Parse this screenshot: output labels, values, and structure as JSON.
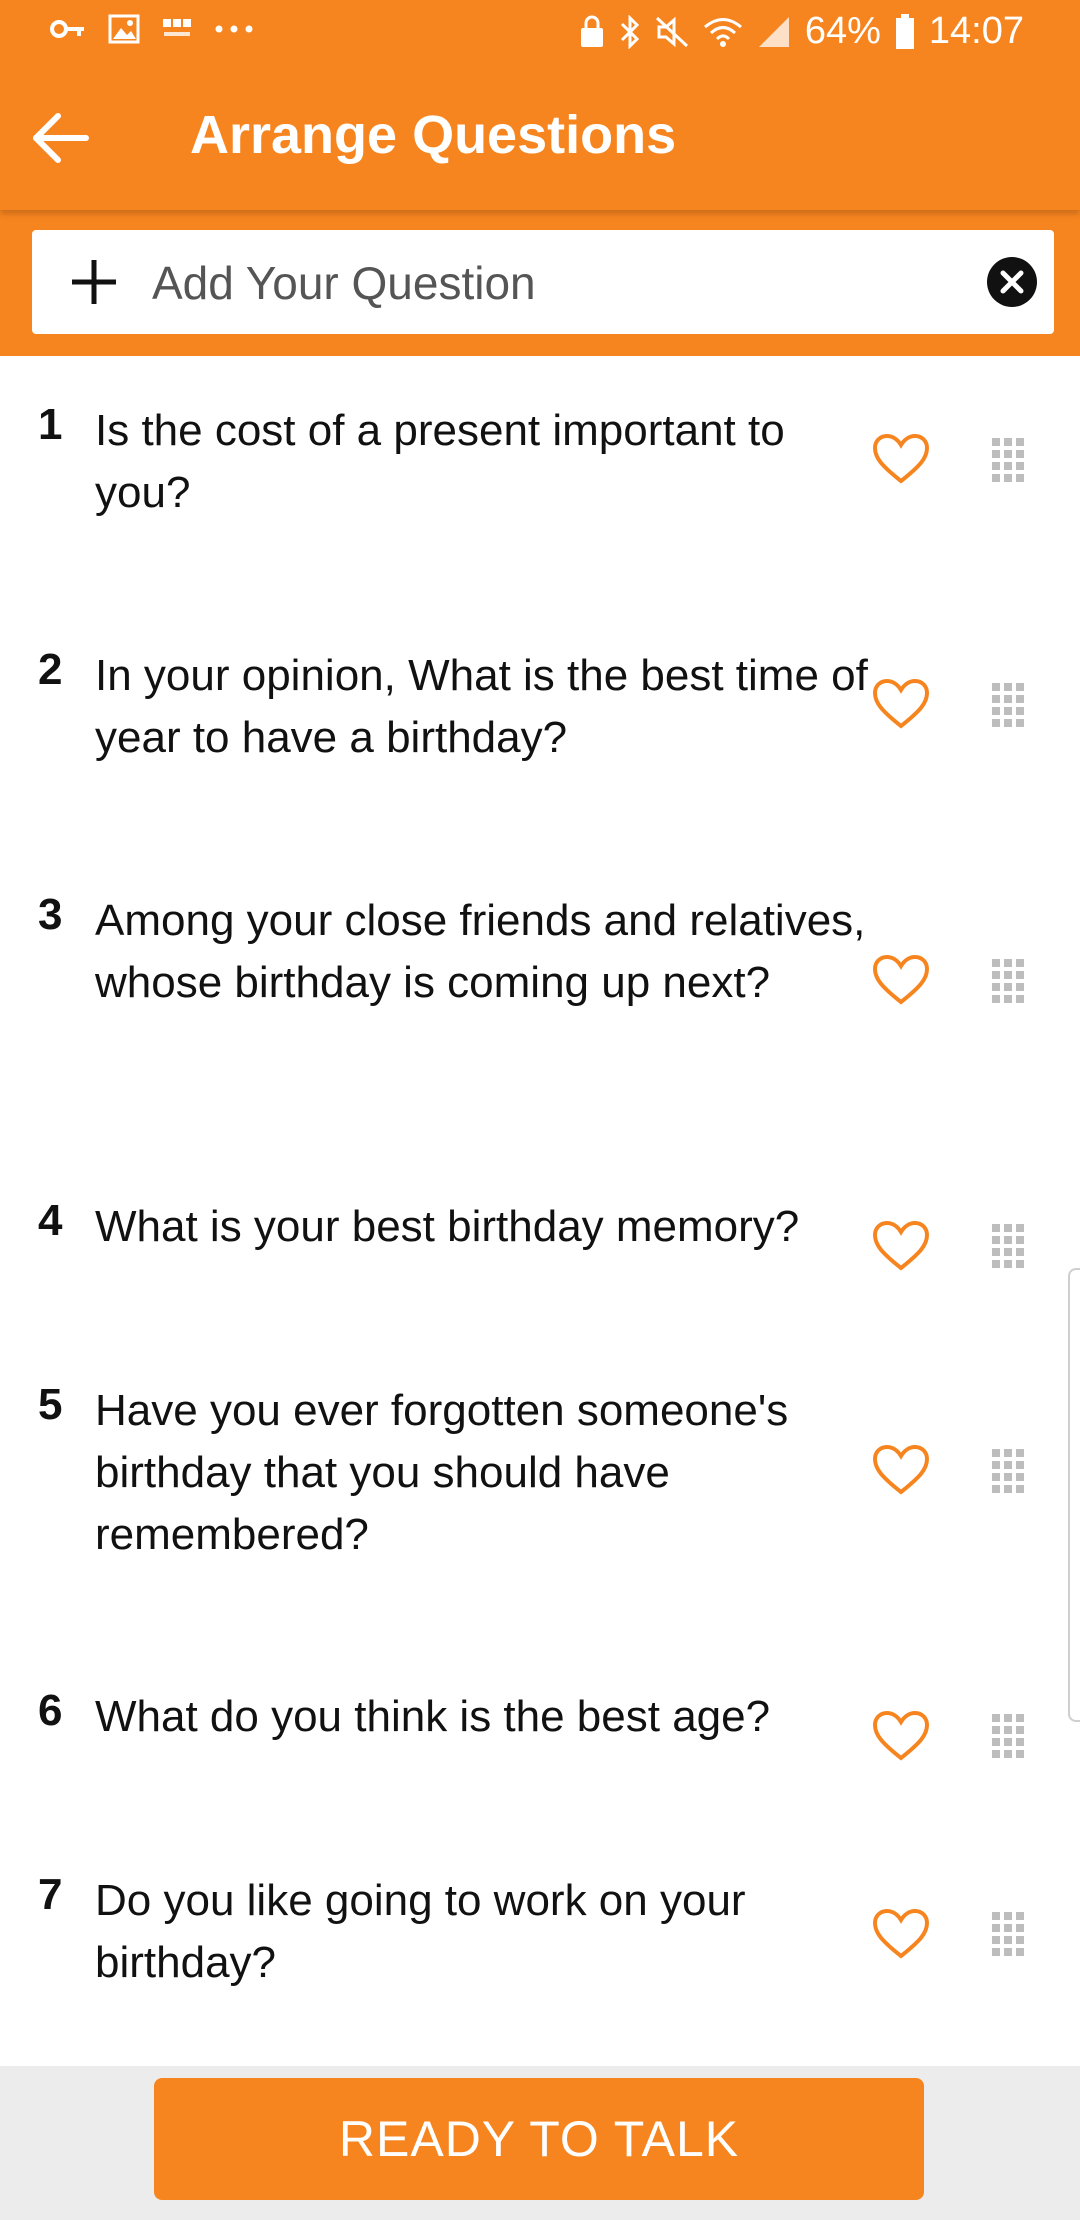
{
  "status_bar": {
    "battery": "64%",
    "time": "14:07"
  },
  "appbar": {
    "title": "Arrange Questions"
  },
  "add_question": {
    "placeholder": "Add Your Question"
  },
  "questions": [
    {
      "num": "1",
      "text": "Is the cost of a present important to you?"
    },
    {
      "num": "2",
      "text": "In your opinion, What is the best time of year to have a birthday?"
    },
    {
      "num": "3",
      "text": "Among your close friends and relatives, whose birthday is coming up next?"
    },
    {
      "num": "4",
      "text": "What is your best birthday memory?"
    },
    {
      "num": "5",
      "text": "Have you ever forgotten someone's birthday that you should have remembered?"
    },
    {
      "num": "6",
      "text": "What do you think is the best age?"
    },
    {
      "num": "7",
      "text": "Do you like going to work on your birthday?"
    }
  ],
  "footer": {
    "ready_label": "READY TO TALK"
  },
  "colors": {
    "accent": "#f7851f",
    "drag_handle": "#bdbdbd"
  },
  "icons": [
    "key-icon",
    "gallery-icon",
    "news-icon",
    "more-dots-icon",
    "lock-icon",
    "bluetooth-icon",
    "mute-icon",
    "wifi-icon",
    "signal-icon",
    "battery-icon",
    "back-arrow-icon",
    "plus-icon",
    "clear-icon",
    "heart-icon",
    "drag-handle-icon"
  ]
}
